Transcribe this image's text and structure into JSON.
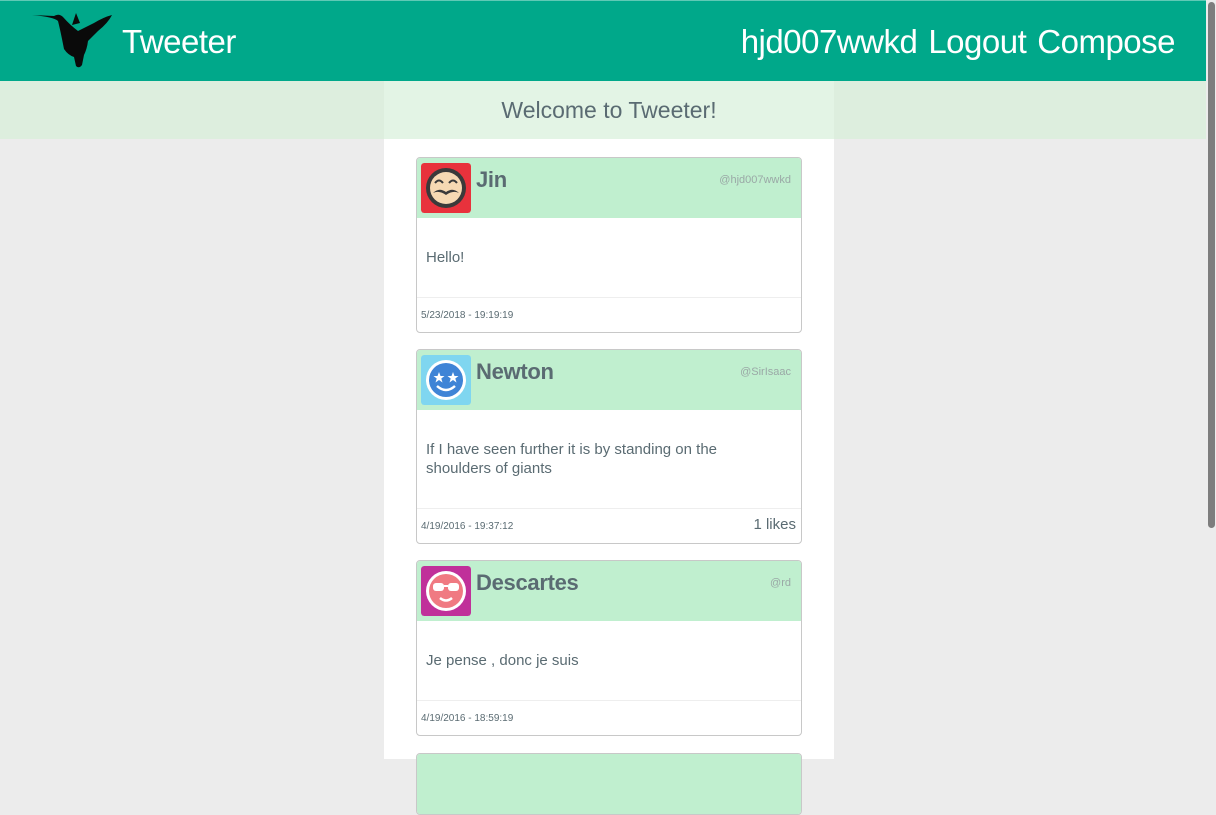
{
  "navbar": {
    "brand": "Tweeter",
    "logo_icon": "hummingbird-icon",
    "username": "hjd007wwkd",
    "logout": "Logout",
    "compose": "Compose"
  },
  "welcome": "Welcome to Tweeter!",
  "tweets": [
    {
      "name": "Jin",
      "handle": "@hjd007wwkd",
      "text": "Hello!",
      "date": "5/23/2018 - 19:19:19",
      "likes": "",
      "avatar_icon": "mustache-face-icon",
      "avatar_color": "#e8323c"
    },
    {
      "name": "Newton",
      "handle": "@SirIsaac",
      "text": "If I have seen further it is by standing on the shoulders of giants",
      "date": "4/19/2016 - 19:37:12",
      "likes": "1 likes",
      "avatar_icon": "star-eyes-face-icon",
      "avatar_color": "#7fd6f0"
    },
    {
      "name": "Descartes",
      "handle": "@rd",
      "text": "Je pense , donc je suis",
      "date": "4/19/2016 - 18:59:19",
      "likes": "",
      "avatar_icon": "sunglasses-face-icon",
      "avatar_color": "#c0309a"
    }
  ],
  "colors": {
    "navbar": "#00a88a",
    "tweet_header": "#c0efcf",
    "text": "#5a6b72"
  }
}
